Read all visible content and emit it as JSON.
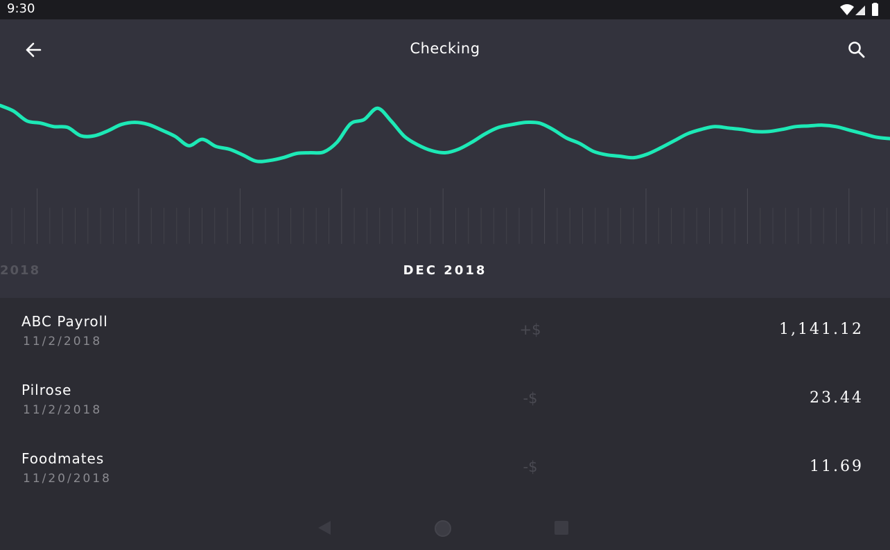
{
  "status_bar": {
    "time": "9:30"
  },
  "app_bar": {
    "title": "Checking"
  },
  "chart_data": {
    "type": "line",
    "y": [
      92,
      84,
      70,
      67,
      62,
      61,
      49,
      49,
      56,
      65,
      68,
      65,
      57,
      48,
      35,
      44,
      34,
      30,
      22,
      13,
      14,
      18,
      24,
      25,
      26,
      40,
      66,
      72,
      88,
      70,
      48,
      36,
      28,
      25,
      30,
      40,
      52,
      61,
      65,
      68,
      67,
      58,
      46,
      38,
      27,
      22,
      20,
      18,
      23,
      32,
      42,
      52,
      58,
      62,
      60,
      58,
      55,
      55,
      58,
      62,
      63,
      64,
      62,
      57,
      52,
      47,
      45
    ]
  },
  "months": {
    "previous": "2018",
    "current": "DEC 2018"
  },
  "transactions": [
    {
      "name": "ABC Payroll",
      "date": "11/2/2018",
      "sign": "+$",
      "amount": "1,141.12"
    },
    {
      "name": "Pilrose",
      "date": "11/2/2018",
      "sign": "-$",
      "amount": "23.44"
    },
    {
      "name": "Foodmates",
      "date": "11/20/2018",
      "sign": "-$",
      "amount": "11.69"
    }
  ],
  "colors": {
    "accent": "#1de9b6",
    "background": "#33333d",
    "list_background": "#2c2c33"
  },
  "icons": {
    "back": "arrow-back-icon",
    "search": "search-icon",
    "nav_back": "nav-back-icon",
    "nav_home": "nav-home-icon",
    "nav_recent": "nav-recent-icon"
  }
}
